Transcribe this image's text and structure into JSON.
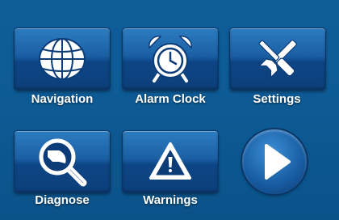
{
  "menu": {
    "items": [
      {
        "label": "Navigation",
        "icon": "globe-icon"
      },
      {
        "label": "Alarm Clock",
        "icon": "alarm-clock-icon"
      },
      {
        "label": "Settings",
        "icon": "tools-icon"
      },
      {
        "label": "Diagnose",
        "icon": "magnifier-icon"
      },
      {
        "label": "Warnings",
        "icon": "warning-icon"
      }
    ],
    "next_icon": "play-arrow-icon"
  },
  "colors": {
    "background": "#0d5a94",
    "tile": "#1b5fa3",
    "label": "#ffffff"
  }
}
